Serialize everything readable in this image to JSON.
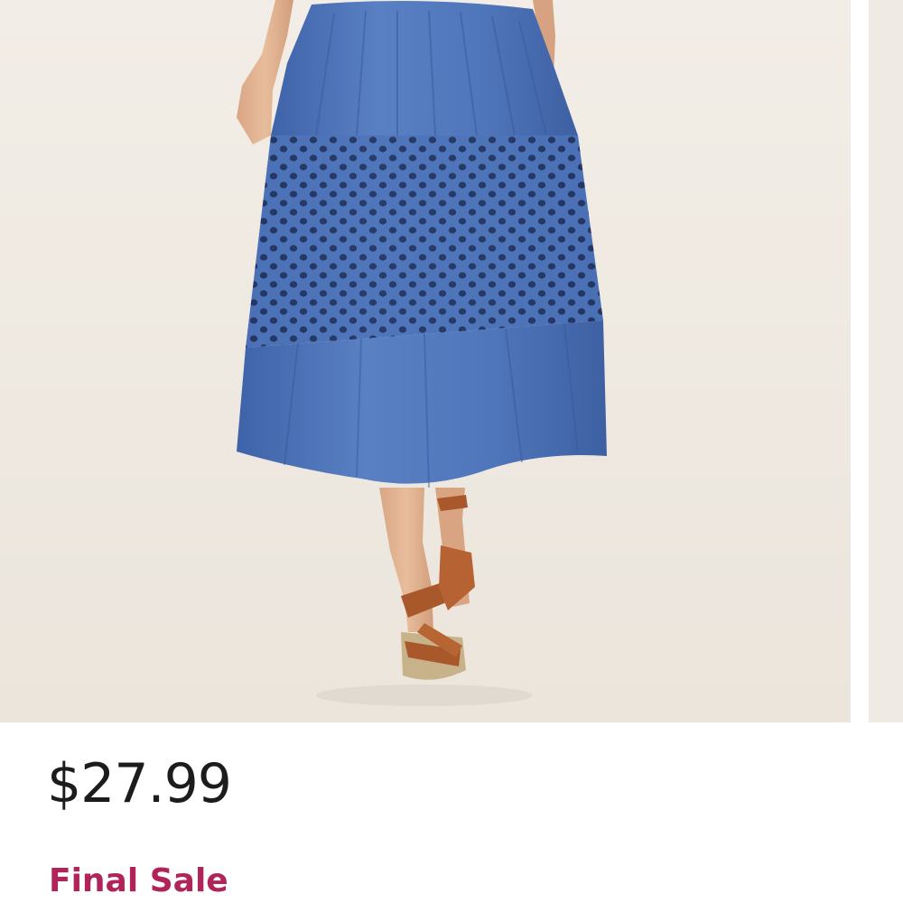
{
  "product": {
    "price": "$27.99",
    "sale_label": "Final Sale",
    "image_alt": "blue eyelet midi skirt product photo"
  },
  "colors": {
    "background": "#ffffff",
    "photo_backdrop": "#f0ebe4",
    "skirt_blue": "#4a6fb5",
    "price_text": "#1c1c1c",
    "sale_accent": "#b0245a"
  },
  "carousel": {
    "visible_slides": 2
  }
}
